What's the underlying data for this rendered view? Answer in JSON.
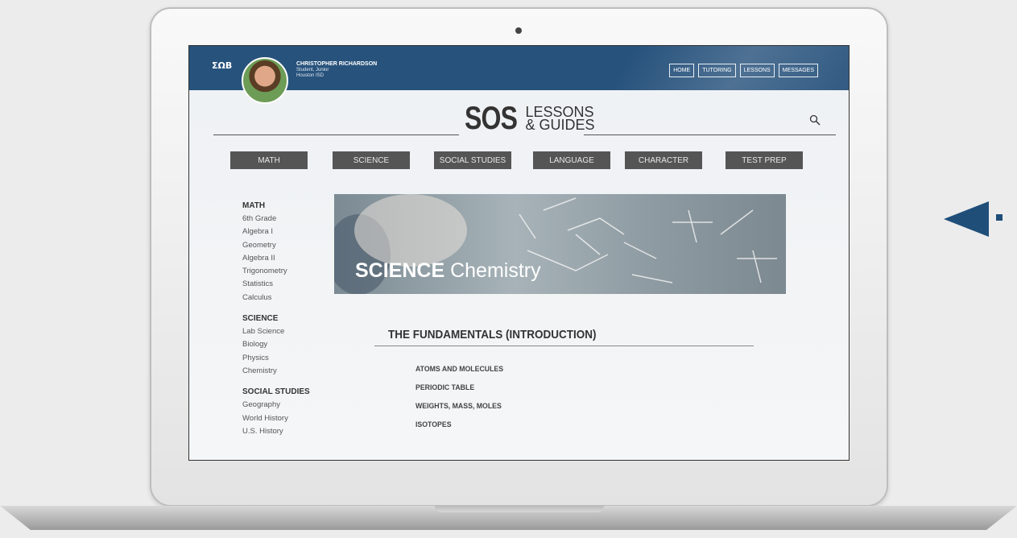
{
  "user": {
    "name": "CHRISTOPHER RICHARDSON",
    "role": "Student, Junior",
    "district": "Houston ISD"
  },
  "logo_small": "ΣΩΒ",
  "top_nav": [
    "HOME",
    "TUTORING",
    "LESSONS",
    "MESSAGES"
  ],
  "brand": {
    "main": "SOS",
    "line1": "LESSONS",
    "line2": "& GUIDES"
  },
  "categories": [
    "MATH",
    "SCIENCE",
    "SOCIAL STUDIES",
    "LANGUAGE",
    "CHARACTER",
    "TEST PREP"
  ],
  "sidebar": [
    {
      "heading": "MATH",
      "items": [
        "6th Grade",
        "Algebra I",
        "Geometry",
        "Algebra II",
        "Trigonometry",
        "Statistics",
        "Calculus"
      ]
    },
    {
      "heading": "SCIENCE",
      "items": [
        "Lab Science",
        "Biology",
        "Physics",
        "Chemistry"
      ]
    },
    {
      "heading": "SOCIAL STUDIES",
      "items": [
        "Geography",
        "World History",
        "U.S. History"
      ]
    }
  ],
  "banner": {
    "subject": "SCIENCE",
    "topic": "Chemistry"
  },
  "section": {
    "title": "THE FUNDAMENTALS (INTRODUCTION)",
    "lessons": [
      "ATOMS AND MOLECULES",
      "PERIODIC TABLE",
      "WEIGHTS, MASS, MOLES",
      "ISOTOPES"
    ]
  },
  "colors": {
    "topbar": "#27527c",
    "category_button": "#555555",
    "accent_arrow": "#1f4e79"
  }
}
